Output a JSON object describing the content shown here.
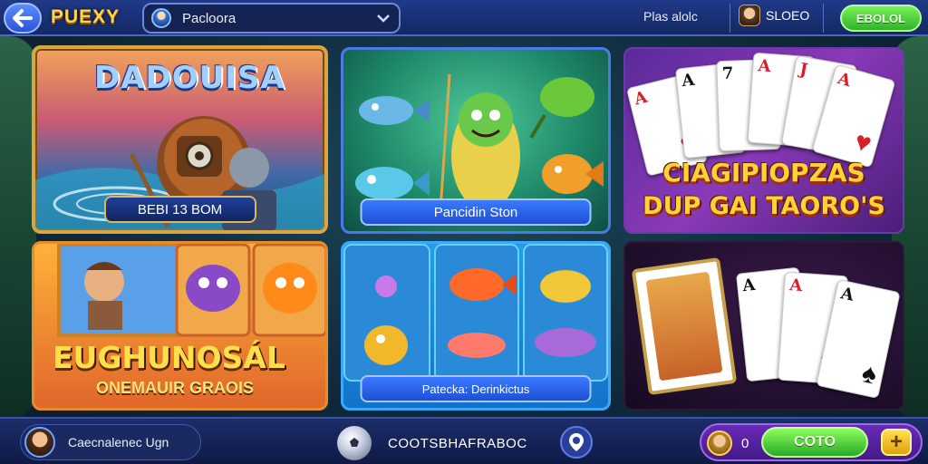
{
  "header": {
    "brand": "PUEXY",
    "search_value": "Pacloora",
    "link": "Plas alolc",
    "profile_name": "SLOEO",
    "play_button": "EBOLOL"
  },
  "games": [
    {
      "title": "DADOUISA",
      "banner": "BEBI 13 BOM"
    },
    {
      "banner": "Pancidin Ston"
    },
    {
      "title_line1": "CIAGIPIOPZAS",
      "title_line2": "DUP GAI TAORO'S"
    },
    {
      "title_line1": "EUGHUNOSÁL",
      "title_line2": "ONEMAUIR GRAOIS"
    },
    {
      "banner": "Patecka: Derinkictus"
    },
    {}
  ],
  "cards_top": [
    {
      "rank": "A",
      "suit": "♥",
      "color": "red"
    },
    {
      "rank": "A",
      "suit": "♠",
      "color": "black"
    },
    {
      "rank": "7",
      "suit": "♠",
      "color": "black"
    },
    {
      "rank": "A",
      "suit": "♥",
      "color": "red"
    },
    {
      "rank": "J",
      "suit": "♥",
      "color": "red"
    },
    {
      "rank": "A",
      "suit": "♥",
      "color": "red"
    }
  ],
  "cards_bottom": [
    {
      "rank": "A",
      "suit": "♠",
      "color": "black"
    },
    {
      "rank": "A",
      "suit": "♥",
      "color": "red"
    },
    {
      "rank": "A",
      "suit": "♠",
      "color": "black"
    }
  ],
  "footer": {
    "user_text": "Caecnalenec Ugn",
    "center_text": "COOTSBHAFRABOC",
    "coin_count": "0",
    "coin_button": "COTO",
    "plus": "+"
  },
  "colors": {
    "accent_green": "#2fb42a",
    "accent_blue": "#2a55d6",
    "accent_gold": "#ffd54a",
    "accent_purple": "#6a2ab8"
  }
}
